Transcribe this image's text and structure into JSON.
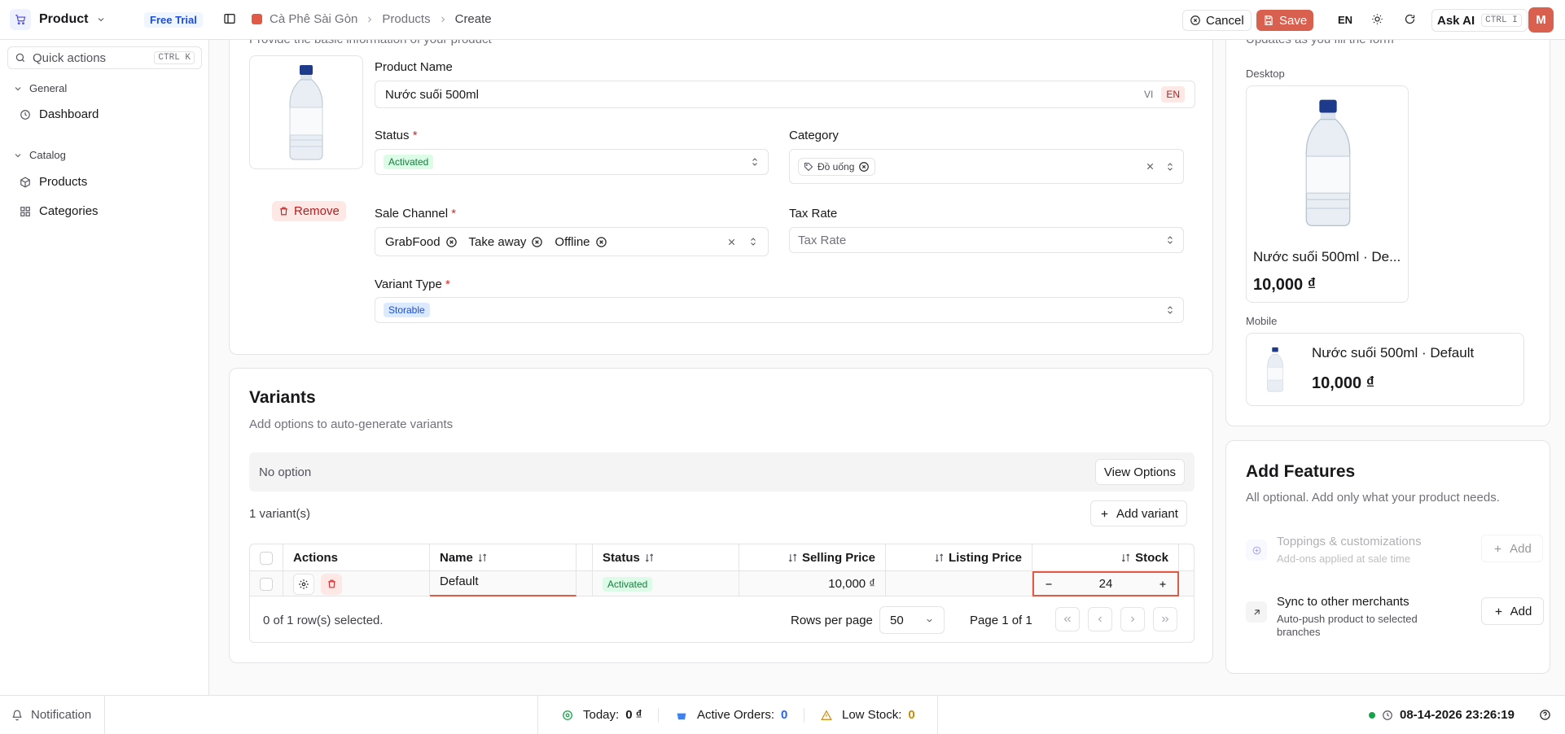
{
  "topbar": {
    "app_name": "Product",
    "plan_badge": "Free Trial",
    "breadcrumb": [
      "Cà Phê Sài Gòn",
      "Products",
      "Create"
    ],
    "cancel_label": "Cancel",
    "save_label": "Save",
    "language": "EN",
    "ask_ai_label": "Ask AI",
    "ask_ai_shortcut": "CTRL I",
    "avatar_initial": "M"
  },
  "sidebar": {
    "search_placeholder": "Quick actions",
    "search_shortcut": "CTRL K",
    "groups": [
      {
        "title": "General",
        "items": [
          {
            "label": "Dashboard",
            "icon": "clock-icon"
          }
        ]
      },
      {
        "title": "Catalog",
        "items": [
          {
            "label": "Products",
            "icon": "box-icon"
          },
          {
            "label": "Categories",
            "icon": "grid-icon"
          }
        ]
      }
    ]
  },
  "basic_info": {
    "subtitle_partial": "Provide the basic information of your product",
    "remove_label": "Remove",
    "product_name_label": "Product Name",
    "product_name_value": "Nước suối 500ml",
    "lang_vi": "VI",
    "lang_en": "EN",
    "status_label": "Status",
    "status_value": "Activated",
    "category_label": "Category",
    "category_value": "Đồ uống",
    "sale_channel_label": "Sale Channel",
    "sale_channels": [
      "GrabFood",
      "Take away",
      "Offline"
    ],
    "tax_rate_label": "Tax Rate",
    "tax_rate_placeholder": "Tax Rate",
    "variant_type_label": "Variant Type",
    "variant_type_value": "Storable",
    "required_mark": "*"
  },
  "variants": {
    "title": "Variants",
    "subtitle": "Add options to auto-generate variants",
    "no_option_text": "No option",
    "view_options_label": "View Options",
    "variant_count": "1 variant(s)",
    "add_variant_label": "Add variant",
    "columns": [
      "Actions",
      "Name",
      "Status",
      "Selling Price",
      "Listing Price",
      "Stock"
    ],
    "rows": [
      {
        "name": "Default",
        "status": "Activated",
        "selling_price": "10,000 ₫",
        "listing_price": "",
        "stock": "24"
      }
    ],
    "selection_text": "0 of 1 row(s) selected.",
    "rows_per_page_label": "Rows per page",
    "rows_per_page_value": "50",
    "page_text": "Page 1 of 1"
  },
  "preview": {
    "subtitle_partial": "Updates as you fill the form",
    "desktop_label": "Desktop",
    "desktop_name": "Nước suối 500ml · De...",
    "desktop_price": "10,000 ₫",
    "mobile_label": "Mobile",
    "mobile_name": "Nước suối 500ml · Default",
    "mobile_price": "10,000 ₫"
  },
  "features": {
    "title": "Add Features",
    "subtitle": "All optional. Add only what your product needs.",
    "items": [
      {
        "title": "Toppings & customizations",
        "desc": "Add-ons applied at sale time",
        "button": "Add",
        "enabled": false
      },
      {
        "title": "Sync to other merchants",
        "desc": "Auto-push product to selected branches",
        "button": "Add",
        "enabled": true
      }
    ]
  },
  "footer": {
    "notification_label": "Notification",
    "today_label": "Today:",
    "today_value": "0 ₫",
    "active_orders_label": "Active Orders:",
    "active_orders_value": "0",
    "low_stock_label": "Low Stock:",
    "low_stock_value": "0",
    "datetime": "08-14-2026 23:26:19"
  },
  "colors": {
    "accent": "#e05a47",
    "save_bg": "#d9604f",
    "status_green": "#15803d",
    "badge_blue": "#1d4ed8",
    "online_dot": "#16a34a"
  }
}
